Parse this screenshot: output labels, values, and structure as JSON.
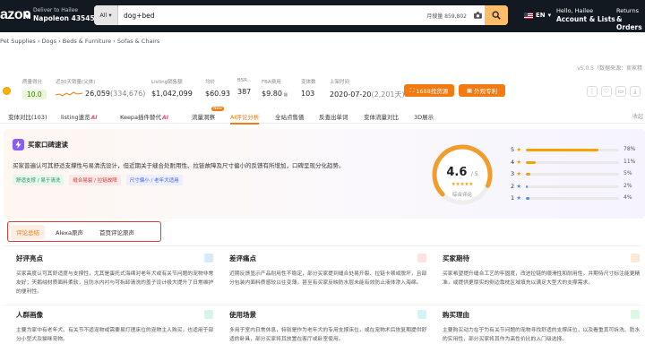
{
  "amazon": {
    "logo": "azon",
    "deliver_line1": "Deliver to Hailee",
    "deliver_line2": "Napoleon 43545",
    "search_category": "All",
    "search_query": "dog+bed",
    "search_volume": "月搜量 859,802",
    "lang": "EN",
    "account_line1": "Hello, Hailee",
    "account_line2": "Account & Lists",
    "returns_line1": "Returns",
    "returns_line2": "& Orders"
  },
  "breadcrumb": "Pet Supplies › Dogs › Beds & Furniture › Sofas & Chairs",
  "version": "v5.0.5（数据来源：卖家精",
  "stats": [
    {
      "label": "质量得分",
      "value": "10.0"
    },
    {
      "label": "近30天销量(父体)",
      "value": "26,059",
      "sub": "(334,676)"
    },
    {
      "label": "Listing销售额",
      "value": "$1,042,099"
    },
    {
      "label": "均价",
      "value": "$60.93"
    },
    {
      "label": "BSR",
      "value": "387"
    },
    {
      "label": "FBA费用",
      "value": "$9.80"
    },
    {
      "label": "变体数",
      "value": "103"
    },
    {
      "label": "上架时间",
      "value": "2020-07-20",
      "sub": "(2,201天)"
    }
  ],
  "buttons": {
    "supplier": "1688找货源",
    "patent": "外观专利"
  },
  "tabs": [
    {
      "label": "变体对比(103)",
      "ai": ""
    },
    {
      "label": "listing速览",
      "ai": "AI"
    },
    {
      "label": "Keepa插件替代",
      "ai": "AI"
    },
    {
      "label": "流量洞察",
      "ai": ""
    },
    {
      "label": "AI评论分析",
      "ai": ""
    },
    {
      "label": "全站点售価",
      "ai": ""
    },
    {
      "label": "反查出单词",
      "ai": ""
    },
    {
      "label": "变体流量对比",
      "ai": ""
    },
    {
      "label": "3D展示",
      "ai": ""
    }
  ],
  "tab_new_badge": "New",
  "collapse": "收起",
  "review": {
    "title": "买家口碑速读",
    "desc": "买家普遍认可其舒适支撑性与易清洗设计，但近期关于缝合处耐用性、拉链故障及尺寸偏小的反馈有所增加，口碑呈现分化趋势。",
    "tags": [
      "舒适支撑 / 易于清洗",
      "缝合易裂 / 拉链故障",
      "尺寸偏小 / 老年犬适用"
    ],
    "score": "4.6",
    "score_max": "/ 5",
    "stars": "★★★★★",
    "score_caption": "综合评论",
    "distribution": [
      {
        "star": "5",
        "pct": 78,
        "label": "78%"
      },
      {
        "star": "4",
        "pct": 11,
        "label": "11%"
      },
      {
        "star": "3",
        "pct": 5,
        "label": "5%"
      },
      {
        "star": "2",
        "pct": 2,
        "label": "2%"
      },
      {
        "star": "1",
        "pct": 4,
        "label": "4%"
      }
    ]
  },
  "section_tabs": [
    "评论总结",
    "Alexa原声",
    "首页评论原声"
  ],
  "cells": [
    {
      "title": "好评亮点",
      "text": "买家高度认可其舒适度与支撑性，尤其是蛋托式海绵对老年犬或有关节问题的宠物非常友好；天鹅绒材质面料柔软，且防水内衬与可拆卸清洗的盖子设计极大提升了日常维护的便利性。",
      "icon_color": "#3b82f6"
    },
    {
      "title": "差评痛点",
      "text": "近期反馈显示产品耐用性不稳定，部分买家提到缝合处易开裂、拉链卡顿或脱坏，且部分包装内面料质感较以往变薄，甚至有买家反映防水层未能有效防止液体渗入海绵。",
      "icon_color": "#ef4444"
    },
    {
      "title": "买家期待",
      "text": "买家希望提升缝合工艺的牢固度，改进拉链的顺滑性和耐用性，并期待尺寸标注能更精准，或提供更厚实的侧边靠枕区域填充以满足大型犬的支撑需求。",
      "icon_color": "#f97316"
    },
    {
      "title": "人群画像",
      "text": "主要为家中有老年犬、有关节不适宠物或需要易打理床位的宠物主人购买，也适用于部分小型犬及猫咪宠物。",
      "icon_color": "#10b981"
    },
    {
      "title": "使用场景",
      "text": "多用于室内日常休息，特别是作为老年犬的专用支撑床位，或在宠物术后恢复期提供舒适的卧具，部分买家将其放置在客厅或卧室使用。",
      "icon_color": "#06b6d4"
    },
    {
      "title": "购买理由",
      "text": "主要购买动力在于为有关节问题的宠物寻找舒适的支撑床位，以及看重其可拆洗、防水的实用性，部分买家将其作为高性价比的入门级选择。",
      "icon_color": "#22c55e"
    }
  ]
}
